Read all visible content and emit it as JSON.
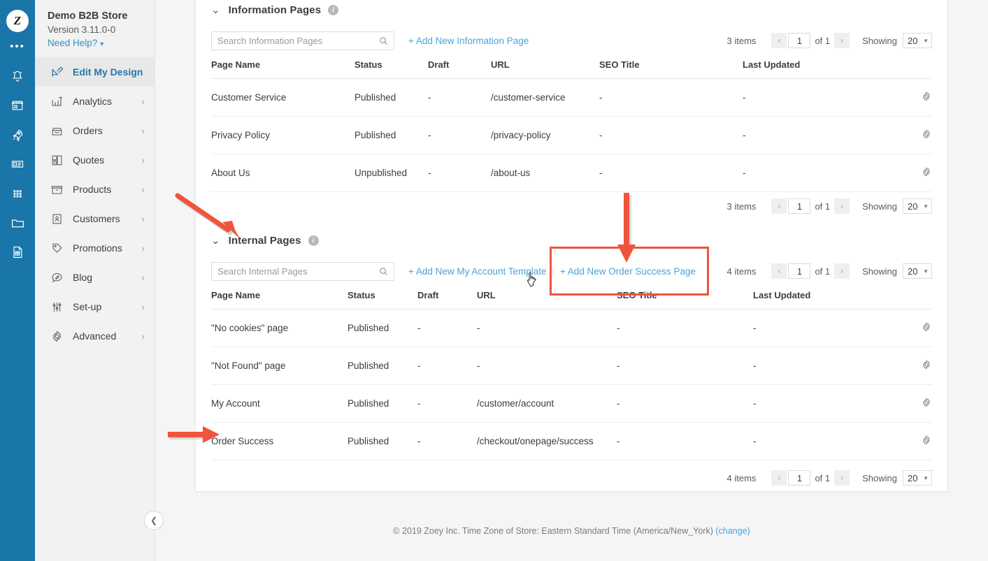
{
  "rail": {
    "logo_text": "Z",
    "icons": [
      {
        "name": "more-dots-icon",
        "label": "More"
      },
      {
        "name": "bell-icon",
        "label": "Notifications"
      },
      {
        "name": "storefront-icon",
        "label": "Storefront"
      },
      {
        "name": "rocket-icon",
        "label": "Launch"
      },
      {
        "name": "news-card-icon",
        "label": "Content"
      },
      {
        "name": "grid-dots-icon",
        "label": "Apps"
      },
      {
        "name": "folder-icon",
        "label": "Files"
      },
      {
        "name": "document-icon",
        "label": "Reports"
      }
    ]
  },
  "sidebar": {
    "store_name": "Demo B2B Store",
    "version": "Version 3.11.0-0",
    "need_help": "Need Help?",
    "items": [
      {
        "label": "Edit My Design",
        "icon": "design-pen-icon",
        "active": true,
        "chevron": false
      },
      {
        "label": "Analytics",
        "icon": "analytics-chart-icon",
        "active": false,
        "chevron": true
      },
      {
        "label": "Orders",
        "icon": "register-icon",
        "active": false,
        "chevron": true
      },
      {
        "label": "Quotes",
        "icon": "quotes-icon",
        "active": false,
        "chevron": true
      },
      {
        "label": "Products",
        "icon": "products-box-icon",
        "active": false,
        "chevron": true
      },
      {
        "label": "Customers",
        "icon": "customers-card-icon",
        "active": false,
        "chevron": true
      },
      {
        "label": "Promotions",
        "icon": "tag-icon",
        "active": false,
        "chevron": true
      },
      {
        "label": "Blog",
        "icon": "blog-bubble-icon",
        "active": false,
        "chevron": true
      },
      {
        "label": "Set-up",
        "icon": "sliders-icon",
        "active": false,
        "chevron": true
      },
      {
        "label": "Advanced",
        "icon": "gear-icon",
        "active": false,
        "chevron": true
      }
    ],
    "collapse_icon": "chevron-left-icon"
  },
  "information_pages": {
    "title": "Information Pages",
    "search_placeholder": "Search Information Pages",
    "search_value": "",
    "add_link": "+ Add New Information Page",
    "columns": [
      "Page Name",
      "Status",
      "Draft",
      "URL",
      "SEO Title",
      "Last Updated"
    ],
    "rows": [
      {
        "page_name": "Customer Service",
        "status": "Published",
        "draft": "-",
        "url": "/customer-service",
        "seo_title": "-",
        "last_updated": "-"
      },
      {
        "page_name": "Privacy Policy",
        "status": "Published",
        "draft": "-",
        "url": "/privacy-policy",
        "seo_title": "-",
        "last_updated": "-"
      },
      {
        "page_name": "About Us",
        "status": "Unpublished",
        "draft": "-",
        "url": "/about-us",
        "seo_title": "-",
        "last_updated": "-"
      }
    ],
    "pager_top": {
      "items_count": "3 items",
      "page": "1",
      "of": "of 1",
      "showing_label": "Showing",
      "page_size": "20"
    },
    "pager_bottom": {
      "items_count": "3 items",
      "page": "1",
      "of": "of 1",
      "showing_label": "Showing",
      "page_size": "20"
    }
  },
  "internal_pages": {
    "title": "Internal Pages",
    "search_placeholder": "Search Internal Pages",
    "search_value": "",
    "add_link_1": "+ Add New My Account Template",
    "add_link_2": "+ Add New Order Success Page",
    "columns": [
      "Page Name",
      "Status",
      "Draft",
      "URL",
      "SEO Title",
      "Last Updated"
    ],
    "rows": [
      {
        "page_name": "\"No cookies\" page",
        "status": "Published",
        "draft": "-",
        "url": "-",
        "seo_title": "-",
        "last_updated": "-"
      },
      {
        "page_name": "\"Not Found\" page",
        "status": "Published",
        "draft": "-",
        "url": "-",
        "seo_title": "-",
        "last_updated": "-"
      },
      {
        "page_name": "My Account",
        "status": "Published",
        "draft": "-",
        "url": "/customer/account",
        "seo_title": "-",
        "last_updated": "-"
      },
      {
        "page_name": "Order Success",
        "status": "Published",
        "draft": "-",
        "url": "/checkout/onepage/success",
        "seo_title": "-",
        "last_updated": "-"
      }
    ],
    "pager_top": {
      "items_count": "4 items",
      "page": "1",
      "of": "of 1",
      "showing_label": "Showing",
      "page_size": "20"
    },
    "pager_bottom": {
      "items_count": "4 items",
      "page": "1",
      "of": "of 1",
      "showing_label": "Showing",
      "page_size": "20"
    }
  },
  "footer": {
    "text": "© 2019 Zoey Inc. Time Zone of Store: Eastern Standard Time (America/New_York)",
    "change_link": "(change)"
  },
  "annotations": {
    "highlight_color": "#f0543c",
    "arrow_to_internal_pages": "diagonal arrow pointing to Internal Pages header",
    "arrow_to_add_order_success": "vertical arrow pointing to + Add New Order Success Page",
    "arrow_to_order_success_row": "horizontal arrow pointing to Order Success row",
    "highlight_box_target": "+ Add New Order Success Page"
  },
  "colors": {
    "rail_blue": "#1a75a8",
    "accent_link": "#4aa3db",
    "active_nav": "#2576a8",
    "status_published": "#3cb371",
    "annotation_red": "#f0543c"
  }
}
